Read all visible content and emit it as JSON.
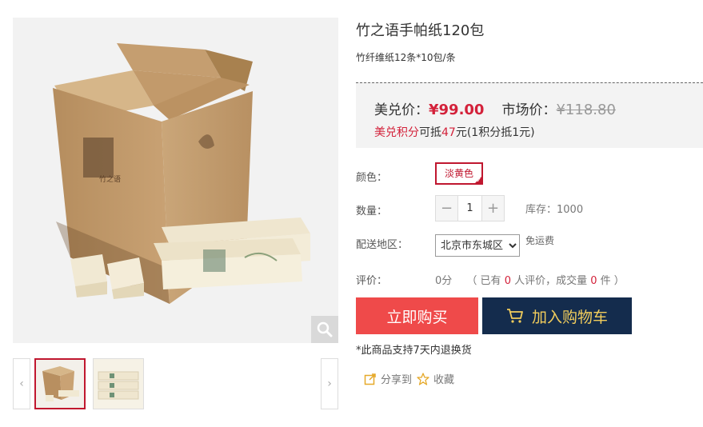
{
  "product": {
    "title": "竹之语手帕纸120包",
    "subtitle": "竹纤维纸12条*10包/条"
  },
  "price": {
    "label": "美兑价：",
    "value": "¥99.00",
    "market_label": "市场价：",
    "market_value": "¥118.80",
    "points_label": "美兑积分",
    "points_text_1": "可抵",
    "points_amount": "47",
    "points_text_2": "元(1积分抵1元)"
  },
  "options": {
    "color_label": "颜色：",
    "color_value": "淡黄色",
    "qty_label": "数量：",
    "qty_value": "1",
    "minus": "−",
    "plus": "+",
    "stock_text": "库存：1000",
    "region_label": "配送地区：",
    "region_selected": "北京市东城区",
    "freight_text": "免运费",
    "rating_label": "评价：",
    "rating_score": "0分",
    "rating_pre": "（ 已有 ",
    "rating_count": "0",
    "rating_mid": " 人评价，成交量 ",
    "rating_sales": "0",
    "rating_post": " 件 ）"
  },
  "actions": {
    "buy_now": "立即购买",
    "add_cart": "加入购物车"
  },
  "notice": "*此商品支持7天内退换货",
  "social": {
    "share": "分享到",
    "favorite": "收藏"
  },
  "gallery": {
    "prev": "‹",
    "next": "›"
  },
  "colors": {
    "accent_red": "#d3213a",
    "buy_bg": "#ef4a4a",
    "cart_bg": "#142c4d",
    "cart_text": "#f2cd5c"
  }
}
